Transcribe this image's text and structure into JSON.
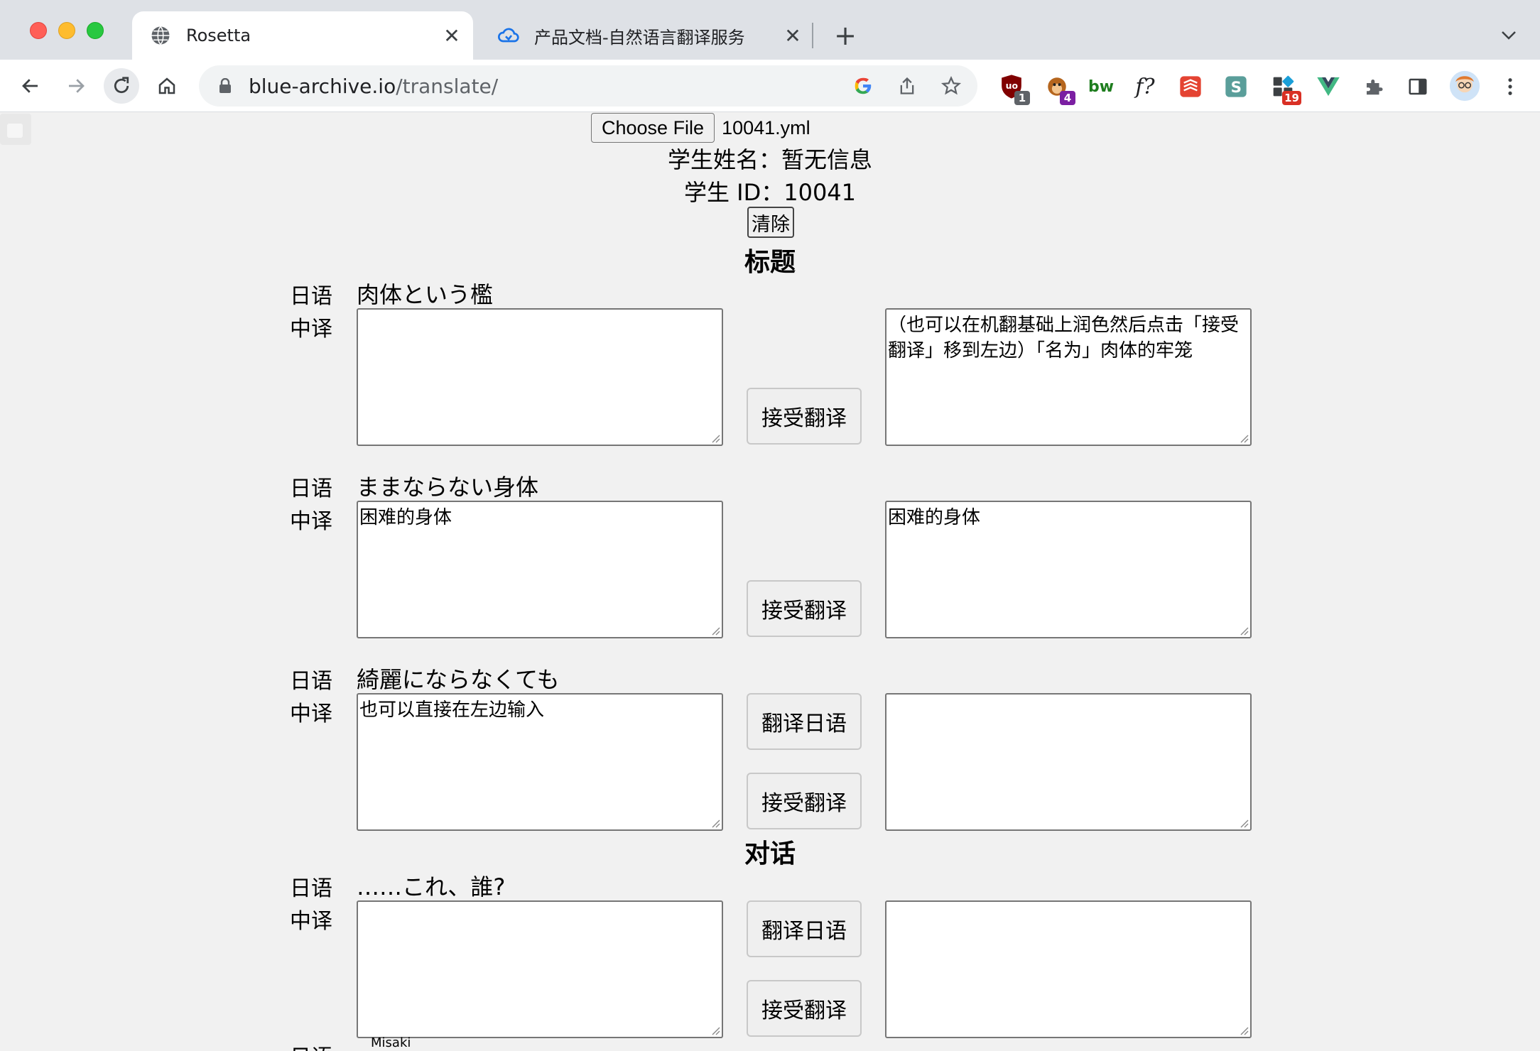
{
  "browser": {
    "tabs": [
      {
        "title": "Rosetta",
        "active": true,
        "favicon": "globe-icon"
      },
      {
        "title": "产品文档-自然语言翻译服务",
        "active": false,
        "favicon": "cloud-icon"
      }
    ],
    "url_host": "blue-archive.io",
    "url_path": "/translate/",
    "extensions": [
      {
        "name": "ublock-icon",
        "badge": "1",
        "badge_color": "#5f6368"
      },
      {
        "name": "monkey-icon",
        "badge": "4",
        "badge_color": "#7b1fa2"
      },
      {
        "name": "bw-icon",
        "label": "bw"
      },
      {
        "name": "formula-icon",
        "label": "f?"
      },
      {
        "name": "todoist-icon"
      },
      {
        "name": "s-icon",
        "label": "S"
      },
      {
        "name": "blocks-icon",
        "badge": "19",
        "badge_color": "#d93025"
      },
      {
        "name": "vue-icon"
      },
      {
        "name": "puzzle-icon"
      },
      {
        "name": "sidepanel-icon"
      },
      {
        "name": "avatar"
      },
      {
        "name": "menu-icon"
      }
    ]
  },
  "page": {
    "file_button": "Choose File",
    "file_name": "10041.yml",
    "student_name": "学生姓名：暂无信息",
    "student_id": "学生 ID：10041",
    "clear_button": "清除",
    "title_section": "标题",
    "dialog_section": "对话",
    "label_jp": "日语",
    "label_cn": "中译",
    "accept_button": "接受翻译",
    "translate_button": "翻译日语",
    "entries": [
      {
        "jp": "肉体という檻",
        "cn": "",
        "mt": "（也可以在机翻基础上润色然后点击「接受翻译」移到左边）「名为」肉体的牢笼"
      },
      {
        "jp": "ままならない身体",
        "cn": "困难的身体",
        "mt": "困难的身体"
      },
      {
        "jp": "綺麗にならなくても",
        "cn": "也可以直接在左边输入",
        "mt": ""
      },
      {
        "jp": "……これ、誰?",
        "cn": "",
        "mt": ""
      }
    ],
    "speaker": "Misaki"
  }
}
